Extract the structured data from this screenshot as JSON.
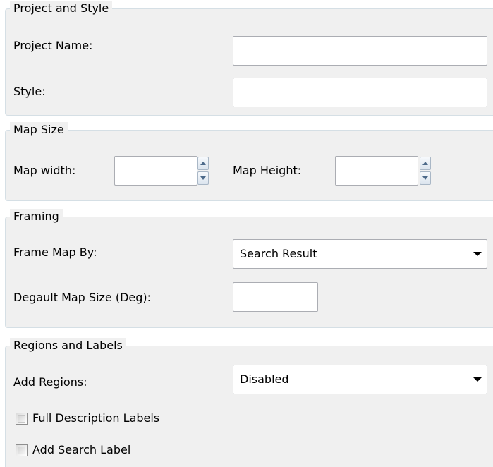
{
  "project_style": {
    "title": "Project and Style",
    "project_name_label": "Project Name:",
    "project_name_value": "",
    "style_label": "Style:",
    "style_value": ""
  },
  "map_size": {
    "title": "Map Size",
    "width_label": "Map width:",
    "width_value": "",
    "height_label": "Map Height:",
    "height_value": ""
  },
  "framing": {
    "title": "Framing",
    "frame_by_label": "Frame Map By:",
    "frame_by_value": "Search Result",
    "default_size_label": "Degault Map Size (Deg):",
    "default_size_value": ""
  },
  "regions_labels": {
    "title": "Regions and Labels",
    "add_regions_label": "Add Regions:",
    "add_regions_value": "Disabled",
    "full_description_label": "Full Description Labels",
    "full_description_checked": false,
    "add_search_label": "Add Search Label",
    "add_search_checked": false
  },
  "icons": {
    "dropdown": "chevron-down-icon",
    "spin_up": "spin-up-icon",
    "spin_down": "spin-down-icon"
  }
}
